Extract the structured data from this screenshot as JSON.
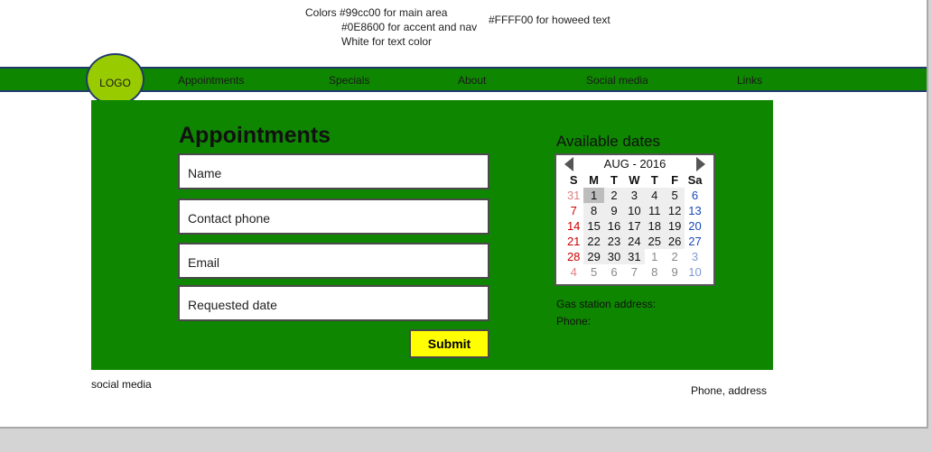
{
  "notes": {
    "line1": "Colors #99cc00 for main area",
    "line2": "#0E8600 for accent and nav",
    "line3": "White for text color",
    "line4": "#FFFF00 for howeed text"
  },
  "colors": {
    "main": "#99cc00",
    "accent": "#0E8600",
    "submit": "#FFFF00",
    "text": "#FFFFFF"
  },
  "logo": {
    "label": "LOGO"
  },
  "nav": {
    "appointments": "Appointments",
    "specials": "Specials",
    "about": "About",
    "social": "Social media",
    "links": "Links"
  },
  "form": {
    "title": "Appointments",
    "name_placeholder": "Name",
    "phone_placeholder": "Contact phone",
    "email_placeholder": "Email",
    "date_placeholder": "Requested date",
    "submit_label": "Submit"
  },
  "calendar": {
    "title": "Available dates",
    "month_label": "AUG - 2016",
    "prev_icon": "left-triangle-icon",
    "next_icon": "right-triangle-icon",
    "weekdays": [
      "S",
      "M",
      "T",
      "W",
      "T",
      "F",
      "Sa"
    ],
    "selected_day": "1",
    "weeks": [
      [
        "31",
        "1",
        "2",
        "3",
        "4",
        "5",
        "6"
      ],
      [
        "7",
        "8",
        "9",
        "10",
        "11",
        "12",
        "13"
      ],
      [
        "14",
        "15",
        "16",
        "17",
        "18",
        "19",
        "20"
      ],
      [
        "21",
        "22",
        "23",
        "24",
        "25",
        "26",
        "27"
      ],
      [
        "28",
        "29",
        "30",
        "31",
        "1",
        "2",
        "3"
      ],
      [
        "4",
        "5",
        "6",
        "7",
        "8",
        "9",
        "10"
      ]
    ]
  },
  "info": {
    "address_label": "Gas station address:",
    "phone_label": "Phone:"
  },
  "footer": {
    "left": "social media",
    "right": "Phone, address"
  }
}
